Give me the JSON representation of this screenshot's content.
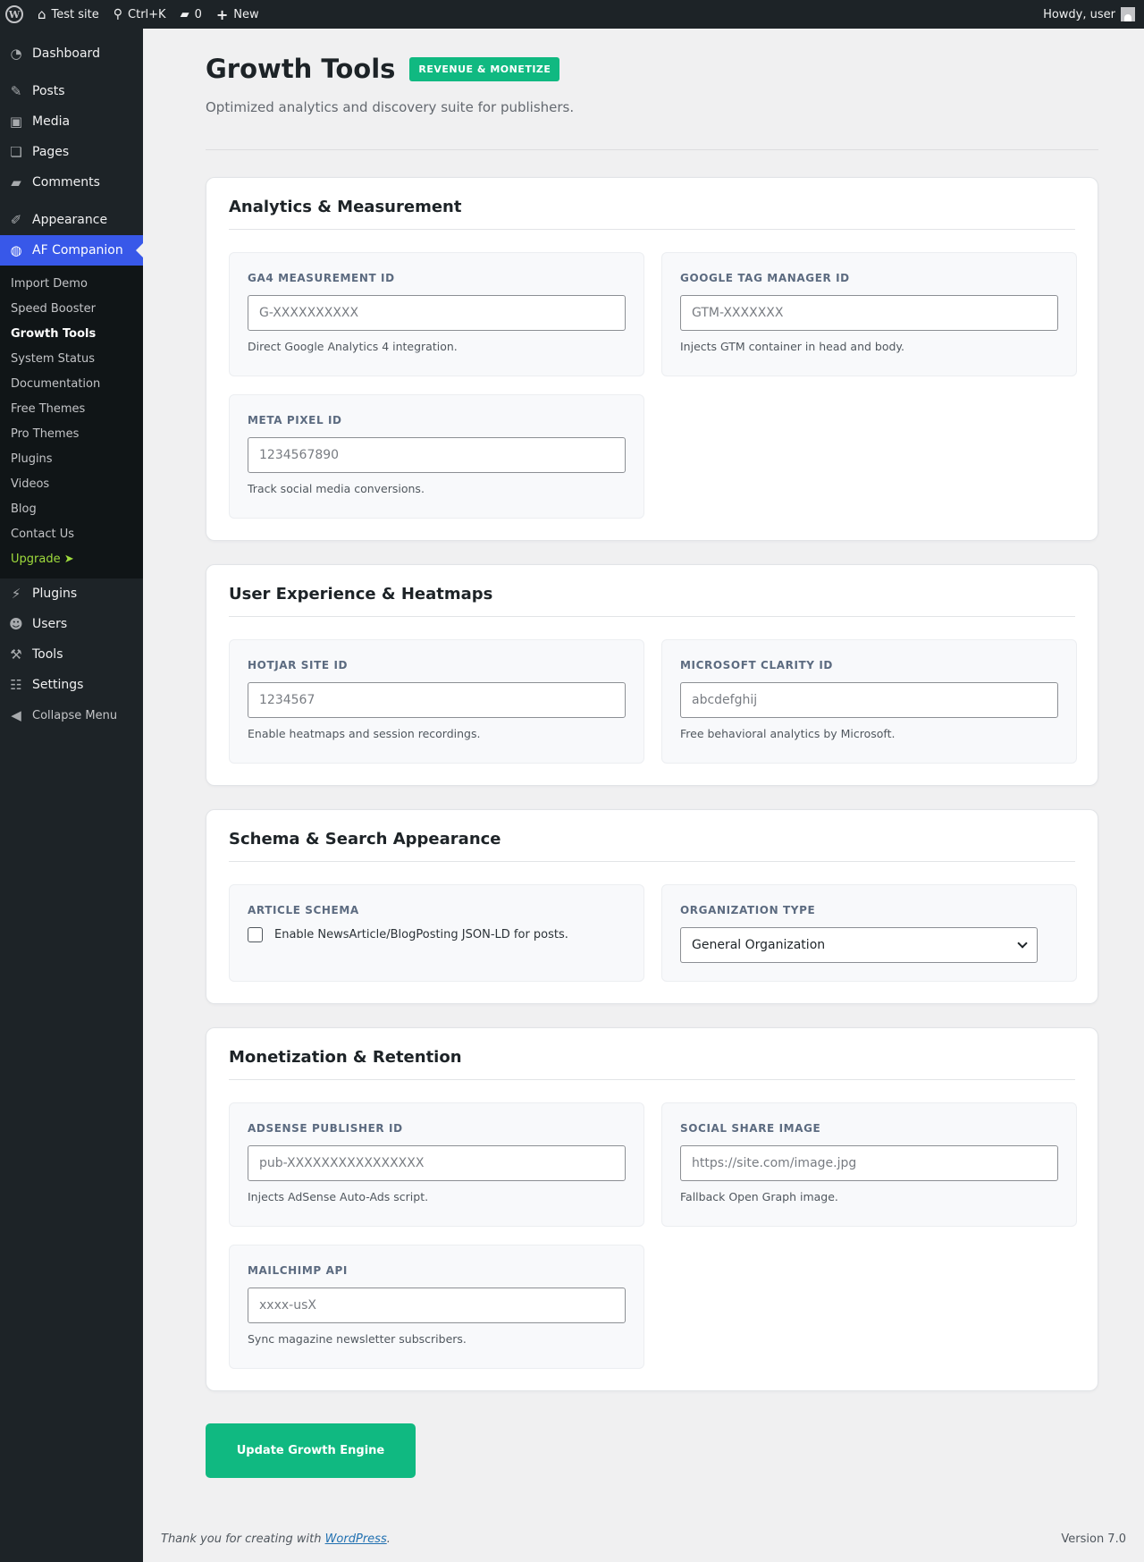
{
  "adminbar": {
    "site_name": "Test site",
    "search_shortcut": "Ctrl+K",
    "comments_count": "0",
    "new_label": "New",
    "howdy": "Howdy, user"
  },
  "sidebar": {
    "top_items": [
      {
        "label": "Dashboard",
        "icon": "dashboard-icon"
      }
    ],
    "content_items": [
      {
        "label": "Posts",
        "icon": "pin-icon"
      },
      {
        "label": "Media",
        "icon": "media-icon"
      },
      {
        "label": "Pages",
        "icon": "pages-icon"
      },
      {
        "label": "Comments",
        "icon": "comment-icon"
      }
    ],
    "appearance": "Appearance",
    "current": "AF Companion",
    "submenu": [
      "Import Demo",
      "Speed Booster",
      "Growth Tools",
      "System Status",
      "Documentation",
      "Free Themes",
      "Pro Themes",
      "Plugins",
      "Videos",
      "Blog",
      "Contact Us",
      "Upgrade ➤"
    ],
    "bottom_items": [
      {
        "label": "Plugins",
        "icon": "plug-icon"
      },
      {
        "label": "Users",
        "icon": "user-icon"
      },
      {
        "label": "Tools",
        "icon": "wrench-icon"
      },
      {
        "label": "Settings",
        "icon": "settings-icon"
      }
    ],
    "collapse": "Collapse Menu"
  },
  "header": {
    "title": "Growth Tools",
    "badge": "REVENUE & MONETIZE",
    "subtitle": "Optimized analytics and discovery suite for publishers."
  },
  "sections": {
    "analytics": {
      "title": "Analytics & Measurement",
      "ga4": {
        "label": "GA4 MEASUREMENT ID",
        "placeholder": "G-XXXXXXXXXX",
        "help": "Direct Google Analytics 4 integration."
      },
      "gtm": {
        "label": "GOOGLE TAG MANAGER ID",
        "placeholder": "GTM-XXXXXXX",
        "help": "Injects GTM container in head and body."
      },
      "meta": {
        "label": "META PIXEL ID",
        "placeholder": "1234567890",
        "help": "Track social media conversions."
      }
    },
    "ux": {
      "title": "User Experience & Heatmaps",
      "hotjar": {
        "label": "HOTJAR SITE ID",
        "placeholder": "1234567",
        "help": "Enable heatmaps and session recordings."
      },
      "clarity": {
        "label": "MICROSOFT CLARITY ID",
        "placeholder": "abcdefghij",
        "help": "Free behavioral analytics by Microsoft."
      }
    },
    "schema": {
      "title": "Schema & Search Appearance",
      "article": {
        "label": "ARTICLE SCHEMA",
        "checkbox_label": "Enable NewsArticle/BlogPosting JSON-LD for posts."
      },
      "org": {
        "label": "ORGANIZATION TYPE",
        "selected": "General Organization"
      }
    },
    "monetization": {
      "title": "Monetization & Retention",
      "adsense": {
        "label": "ADSENSE PUBLISHER ID",
        "placeholder": "pub-XXXXXXXXXXXXXXXX",
        "help": "Injects AdSense Auto-Ads script."
      },
      "social": {
        "label": "SOCIAL SHARE IMAGE",
        "placeholder": "https://site.com/image.jpg",
        "help": "Fallback Open Graph image."
      },
      "mailchimp": {
        "label": "MAILCHIMP API",
        "placeholder": "xxxx-usX",
        "help": "Sync magazine newsletter subscribers."
      }
    }
  },
  "submit_label": "Update Growth Engine",
  "footer": {
    "thanks_prefix": "Thank you for creating with ",
    "wordpress_link": "WordPress",
    "thanks_suffix": ".",
    "version": "Version 7.0"
  },
  "colors": {
    "accent": "#10b981",
    "current_menu": "#3858e9",
    "sidebar_bg": "#1d2327"
  }
}
